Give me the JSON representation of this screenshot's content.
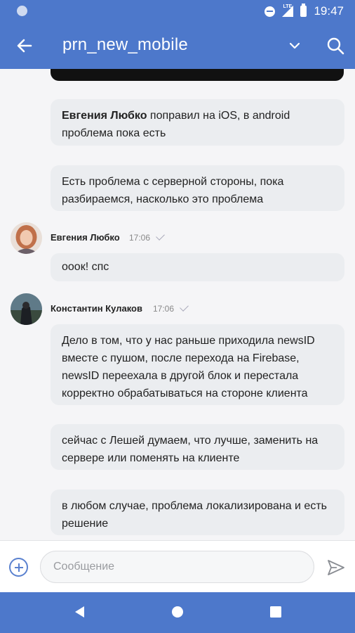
{
  "status_bar": {
    "time": "19:47",
    "network": "LTE"
  },
  "header": {
    "title": "prn_new_mobile"
  },
  "messages": {
    "m1": {
      "bold_prefix": "Евгения Любко",
      "text": " поправил на iOS, в android проблема пока есть"
    },
    "m2": {
      "text": "Есть проблема с серверной стороны, пока разбираемся, насколько это проблема"
    },
    "g1": {
      "sender": "Евгения Любко",
      "time": "17:06",
      "text": "ооок! спс"
    },
    "g2": {
      "sender": "Константин Кулаков",
      "time": "17:06",
      "texts": [
        "Дело в том, что у нас раньше приходила newsID вместе с пушом, после перехода на Firebase, newsID переехала в другой блок и перестала корректно обрабатываться на стороне клиента",
        "сейчас с Лешей думаем, что лучше, заменить на сервере или поменять на клиенте",
        "в любом случае, проблема локализирована и есть решение"
      ]
    }
  },
  "composer": {
    "placeholder": "Сообщение"
  },
  "colors": {
    "accent": "#4d78cb",
    "bubble": "#ebedf0",
    "background": "#f5f5f7"
  },
  "icons": {
    "back": "arrow-left-icon",
    "dropdown": "chevron-down-icon",
    "search": "search-icon",
    "attach": "plus-circle-icon",
    "send": "send-icon",
    "nav_back": "triangle-back-icon",
    "nav_home": "circle-home-icon",
    "nav_recent": "square-recent-icon"
  }
}
